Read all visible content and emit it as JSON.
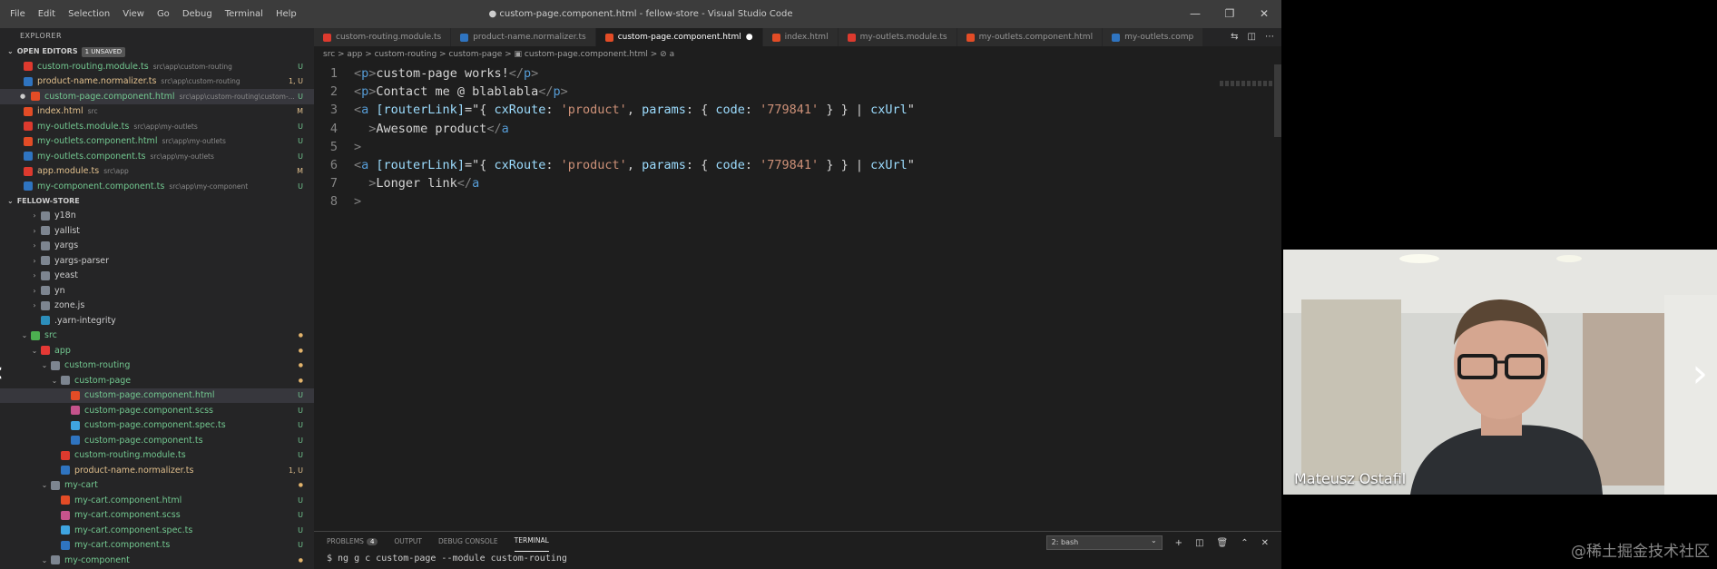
{
  "titlebar": {
    "menu": [
      "File",
      "Edit",
      "Selection",
      "View",
      "Go",
      "Debug",
      "Terminal",
      "Help"
    ],
    "title": "● custom-page.component.html - fellow-store - Visual Studio Code"
  },
  "sidebar": {
    "title": "EXPLORER",
    "open_editors_label": "OPEN EDITORS",
    "unsaved_badge": "1 UNSAVED",
    "open_editors": [
      {
        "name": "custom-routing.module.ts",
        "path": "src\\app\\custom-routing",
        "status": "U",
        "icon": "angular-icon",
        "color": "g"
      },
      {
        "name": "product-name.normalizer.ts",
        "path": "src\\app\\custom-routing",
        "status": "1, U",
        "icon": "typescript-icon",
        "color": "y"
      },
      {
        "name": "custom-page.component.html",
        "path": "src\\app\\custom-routing\\custom-...",
        "status": "U",
        "icon": "html-icon",
        "color": "g"
      },
      {
        "name": "index.html",
        "path": "src",
        "status": "M",
        "icon": "html-icon",
        "color": "y"
      },
      {
        "name": "my-outlets.module.ts",
        "path": "src\\app\\my-outlets",
        "status": "U",
        "icon": "angular-icon",
        "color": "g"
      },
      {
        "name": "my-outlets.component.html",
        "path": "src\\app\\my-outlets",
        "status": "U",
        "icon": "html-icon",
        "color": "g"
      },
      {
        "name": "my-outlets.component.ts",
        "path": "src\\app\\my-outlets",
        "status": "U",
        "icon": "angular-ts-icon",
        "color": "g"
      },
      {
        "name": "app.module.ts",
        "path": "src\\app",
        "status": "M",
        "icon": "angular-icon",
        "color": "y"
      },
      {
        "name": "my-component.component.ts",
        "path": "src\\app\\my-component",
        "status": "U",
        "icon": "angular-ts-icon",
        "color": "g"
      }
    ],
    "project_label": "FELLOW-STORE",
    "tree": [
      {
        "name": "y18n",
        "indent": 1,
        "chev": "›",
        "icon": "folder-icon",
        "color": "w",
        "status": ""
      },
      {
        "name": "yallist",
        "indent": 1,
        "chev": "›",
        "icon": "folder-icon",
        "color": "w",
        "status": ""
      },
      {
        "name": "yargs",
        "indent": 1,
        "chev": "›",
        "icon": "folder-icon",
        "color": "w",
        "status": ""
      },
      {
        "name": "yargs-parser",
        "indent": 1,
        "chev": "›",
        "icon": "folder-icon",
        "color": "w",
        "status": ""
      },
      {
        "name": "yeast",
        "indent": 1,
        "chev": "›",
        "icon": "folder-icon",
        "color": "w",
        "status": ""
      },
      {
        "name": "yn",
        "indent": 1,
        "chev": "›",
        "icon": "folder-icon",
        "color": "w",
        "status": ""
      },
      {
        "name": "zone.js",
        "indent": 1,
        "chev": "›",
        "icon": "folder-icon",
        "color": "w",
        "status": ""
      },
      {
        "name": ".yarn-integrity",
        "indent": 1,
        "chev": "",
        "icon": "yarn-icon",
        "color": "w",
        "status": ""
      },
      {
        "name": "src",
        "indent": 0,
        "chev": "⌄",
        "icon": "src-folder-icon",
        "color": "g",
        "status": "●"
      },
      {
        "name": "app",
        "indent": 1,
        "chev": "⌄",
        "icon": "app-folder-icon",
        "color": "g",
        "status": "●"
      },
      {
        "name": "custom-routing",
        "indent": 2,
        "chev": "⌄",
        "icon": "folder-icon",
        "color": "g",
        "status": "●"
      },
      {
        "name": "custom-page",
        "indent": 3,
        "chev": "⌄",
        "icon": "folder-icon",
        "color": "g",
        "status": "●"
      },
      {
        "name": "custom-page.component.html",
        "indent": 4,
        "chev": "",
        "icon": "html-icon",
        "color": "g",
        "status": "U",
        "selected": true
      },
      {
        "name": "custom-page.component.scss",
        "indent": 4,
        "chev": "",
        "icon": "scss-icon",
        "color": "g",
        "status": "U"
      },
      {
        "name": "custom-page.component.spec.ts",
        "indent": 4,
        "chev": "",
        "icon": "spec-icon",
        "color": "g",
        "status": "U"
      },
      {
        "name": "custom-page.component.ts",
        "indent": 4,
        "chev": "",
        "icon": "angular-ts-icon",
        "color": "g",
        "status": "U"
      },
      {
        "name": "custom-routing.module.ts",
        "indent": 3,
        "chev": "",
        "icon": "angular-icon",
        "color": "g",
        "status": "U"
      },
      {
        "name": "product-name.normalizer.ts",
        "indent": 3,
        "chev": "",
        "icon": "typescript-icon",
        "color": "y",
        "status": "1, U"
      },
      {
        "name": "my-cart",
        "indent": 2,
        "chev": "⌄",
        "icon": "folder-icon",
        "color": "g",
        "status": "●"
      },
      {
        "name": "my-cart.component.html",
        "indent": 3,
        "chev": "",
        "icon": "html-icon",
        "color": "g",
        "status": "U"
      },
      {
        "name": "my-cart.component.scss",
        "indent": 3,
        "chev": "",
        "icon": "scss-icon",
        "color": "g",
        "status": "U"
      },
      {
        "name": "my-cart.component.spec.ts",
        "indent": 3,
        "chev": "",
        "icon": "spec-icon",
        "color": "g",
        "status": "U"
      },
      {
        "name": "my-cart.component.ts",
        "indent": 3,
        "chev": "",
        "icon": "angular-ts-icon",
        "color": "g",
        "status": "U"
      },
      {
        "name": "my-component",
        "indent": 2,
        "chev": "⌄",
        "icon": "folder-icon",
        "color": "g",
        "status": "●"
      }
    ]
  },
  "tabs": [
    {
      "label": "custom-routing.module.ts",
      "icon": "angular-icon",
      "active": false
    },
    {
      "label": "product-name.normalizer.ts",
      "icon": "typescript-icon",
      "active": false
    },
    {
      "label": "custom-page.component.html",
      "icon": "html-icon",
      "active": true,
      "dirty": "●"
    },
    {
      "label": "index.html",
      "icon": "html-icon",
      "active": false
    },
    {
      "label": "my-outlets.module.ts",
      "icon": "angular-icon",
      "active": false
    },
    {
      "label": "my-outlets.component.html",
      "icon": "html-icon",
      "active": false
    },
    {
      "label": "my-outlets.comp",
      "icon": "angular-ts-icon",
      "active": false
    }
  ],
  "breadcrumb": "src > app > custom-routing > custom-page > ▣ custom-page.component.html > ⊘ a",
  "code_lines": [
    [
      {
        "t": "<",
        "c": "tg"
      },
      {
        "t": "p",
        "c": "tn"
      },
      {
        "t": ">",
        "c": "tg"
      },
      {
        "t": "custom-page works!",
        "c": "tx"
      },
      {
        "t": "</",
        "c": "tg"
      },
      {
        "t": "p",
        "c": "tn"
      },
      {
        "t": ">",
        "c": "tg"
      }
    ],
    [
      {
        "t": "<",
        "c": "tg"
      },
      {
        "t": "p",
        "c": "tn"
      },
      {
        "t": ">",
        "c": "tg"
      },
      {
        "t": "Contact me @ blablabla",
        "c": "tx"
      },
      {
        "t": "</",
        "c": "tg"
      },
      {
        "t": "p",
        "c": "tn"
      },
      {
        "t": ">",
        "c": "tg"
      }
    ],
    [
      {
        "t": "<",
        "c": "tg"
      },
      {
        "t": "a",
        "c": "tn"
      },
      {
        "t": " [routerLink]",
        "c": "at"
      },
      {
        "t": "=\"",
        "c": "tx"
      },
      {
        "t": "{ ",
        "c": "tx"
      },
      {
        "t": "cxRoute",
        "c": "kw"
      },
      {
        "t": ": ",
        "c": "tx"
      },
      {
        "t": "'product'",
        "c": "st"
      },
      {
        "t": ", ",
        "c": "tx"
      },
      {
        "t": "params",
        "c": "kw"
      },
      {
        "t": ": { ",
        "c": "tx"
      },
      {
        "t": "code",
        "c": "kw"
      },
      {
        "t": ": ",
        "c": "tx"
      },
      {
        "t": "'779841'",
        "c": "st"
      },
      {
        "t": " } } | ",
        "c": "tx"
      },
      {
        "t": "cxUrl",
        "c": "kw"
      },
      {
        "t": "\"",
        "c": "tx"
      }
    ],
    [
      {
        "t": "  >",
        "c": "tg"
      },
      {
        "t": "Awesome product",
        "c": "tx"
      },
      {
        "t": "</",
        "c": "tg"
      },
      {
        "t": "a",
        "c": "tn"
      }
    ],
    [
      {
        "t": ">",
        "c": "tg"
      }
    ],
    [
      {
        "t": "<",
        "c": "tg"
      },
      {
        "t": "a",
        "c": "tn"
      },
      {
        "t": " [routerLink]",
        "c": "at"
      },
      {
        "t": "=\"",
        "c": "tx"
      },
      {
        "t": "{ ",
        "c": "tx"
      },
      {
        "t": "cxRoute",
        "c": "kw"
      },
      {
        "t": ": ",
        "c": "tx"
      },
      {
        "t": "'product'",
        "c": "st"
      },
      {
        "t": ", ",
        "c": "tx"
      },
      {
        "t": "params",
        "c": "kw"
      },
      {
        "t": ": { ",
        "c": "tx"
      },
      {
        "t": "code",
        "c": "kw"
      },
      {
        "t": ": ",
        "c": "tx"
      },
      {
        "t": "'779841'",
        "c": "st"
      },
      {
        "t": " } } | ",
        "c": "tx"
      },
      {
        "t": "cxUrl",
        "c": "kw"
      },
      {
        "t": "\"",
        "c": "tx"
      }
    ],
    [
      {
        "t": "  >",
        "c": "tg"
      },
      {
        "t": "Longer link",
        "c": "tx"
      },
      {
        "t": "</",
        "c": "tg"
      },
      {
        "t": "a",
        "c": "tn"
      }
    ],
    [
      {
        "t": ">",
        "c": "tg"
      }
    ]
  ],
  "panel": {
    "tabs": [
      "PROBLEMS",
      "OUTPUT",
      "DEBUG CONSOLE",
      "TERMINAL"
    ],
    "problems_count": "4",
    "active": "TERMINAL",
    "terminal_select": "2: bash",
    "terminal_line": "$ ng g c custom-page --module custom-routing"
  },
  "webcam": {
    "name": "Mateusz Ostafil"
  },
  "watermark": "@稀土掘金技术社区",
  "colors": {
    "accent": "#007acc",
    "editor_bg": "#1e1e1e",
    "sidebar_bg": "#252526"
  }
}
